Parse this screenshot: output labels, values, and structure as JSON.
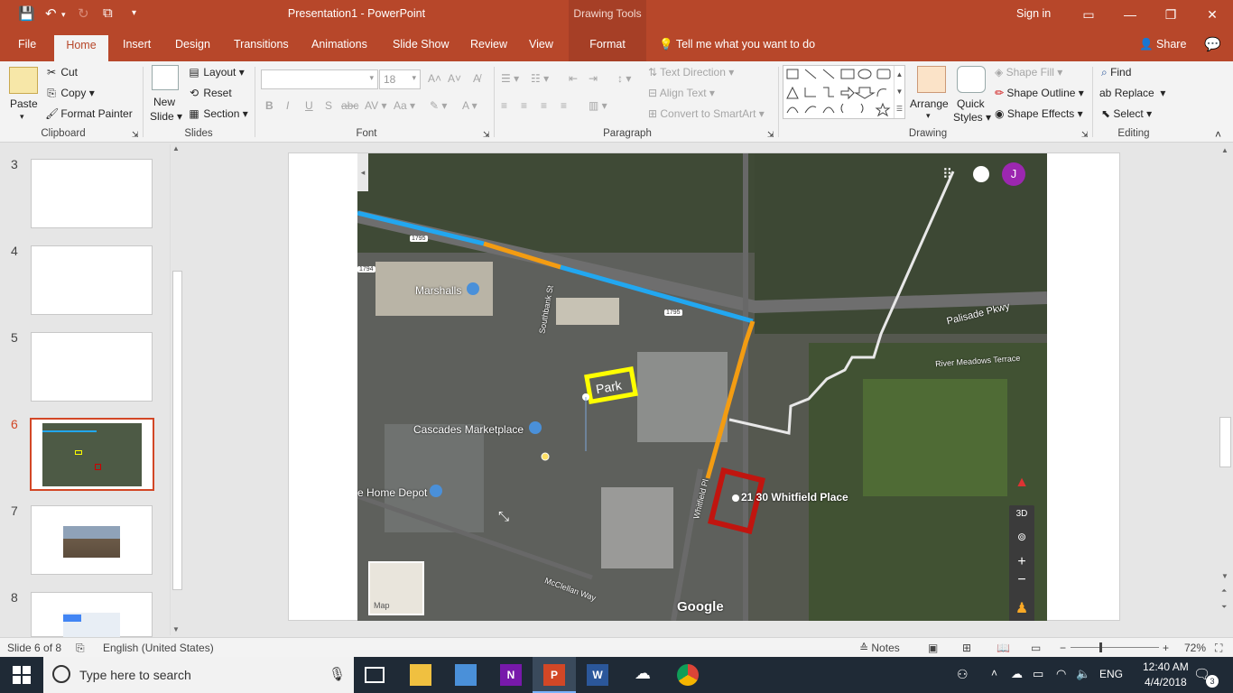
{
  "titlebar": {
    "title": "Presentation1  -  PowerPoint",
    "contextual": "Drawing Tools",
    "signin": "Sign in"
  },
  "tabs": {
    "file": "File",
    "home": "Home",
    "insert": "Insert",
    "design": "Design",
    "transitions": "Transitions",
    "animations": "Animations",
    "slideshow": "Slide Show",
    "review": "Review",
    "view": "View",
    "format": "Format",
    "tellme": "Tell me what you want to do",
    "share": "Share"
  },
  "ribbon": {
    "clipboard": {
      "paste": "Paste",
      "cut": "Cut",
      "copy": "Copy",
      "format_painter": "Format Painter",
      "label": "Clipboard"
    },
    "slides": {
      "new_slide_1": "New",
      "new_slide_2": "Slide",
      "layout": "Layout",
      "reset": "Reset",
      "section": "Section",
      "label": "Slides"
    },
    "font": {
      "size": "18",
      "label": "Font"
    },
    "paragraph": {
      "text_direction": "Text Direction",
      "align_text": "Align Text",
      "convert": "Convert to SmartArt",
      "label": "Paragraph"
    },
    "drawing": {
      "arrange": "Arrange",
      "quick_1": "Quick",
      "quick_2": "Styles",
      "shape_fill": "Shape Fill",
      "shape_outline": "Shape Outline",
      "shape_effects": "Shape Effects",
      "label": "Drawing"
    },
    "editing": {
      "find": "Find",
      "replace": "Replace",
      "select": "Select",
      "label": "Editing"
    }
  },
  "slides": [
    {
      "num": "3"
    },
    {
      "num": "4"
    },
    {
      "num": "5"
    },
    {
      "num": "6"
    },
    {
      "num": "7"
    },
    {
      "num": "8"
    }
  ],
  "map": {
    "labels": {
      "marshalls": "Marshalls",
      "cascades": "Cascades Marketplace",
      "home_depot": "e Home Depot",
      "address": "21  30 Whitfield Place",
      "palisade": "Palisade Pkwy",
      "river": "River Meadows Terrace",
      "mcclellan": "McClellan Way",
      "whitfield": "Whitfield Pl",
      "southbank": "Southbank St",
      "shield1": "1795",
      "shield2": "1794",
      "shield3": "1795",
      "google": "Google",
      "map_btn": "Map",
      "btn_3d": "3D",
      "avatar": "J",
      "callout": "Park"
    },
    "route_colors": {
      "blue": "#22a7f0",
      "orange": "#f39c12",
      "white": "#e8e8e8",
      "box_yellow": "#ffff00",
      "box_red": "#c0150f"
    }
  },
  "status": {
    "slide_of": "Slide 6 of 8",
    "language": "English (United States)",
    "notes": "Notes",
    "zoom": "72%"
  },
  "taskbar": {
    "search": "Type here to search",
    "lang": "ENG",
    "time": "12:40 AM",
    "date": "4/4/2018",
    "notif": "3"
  }
}
